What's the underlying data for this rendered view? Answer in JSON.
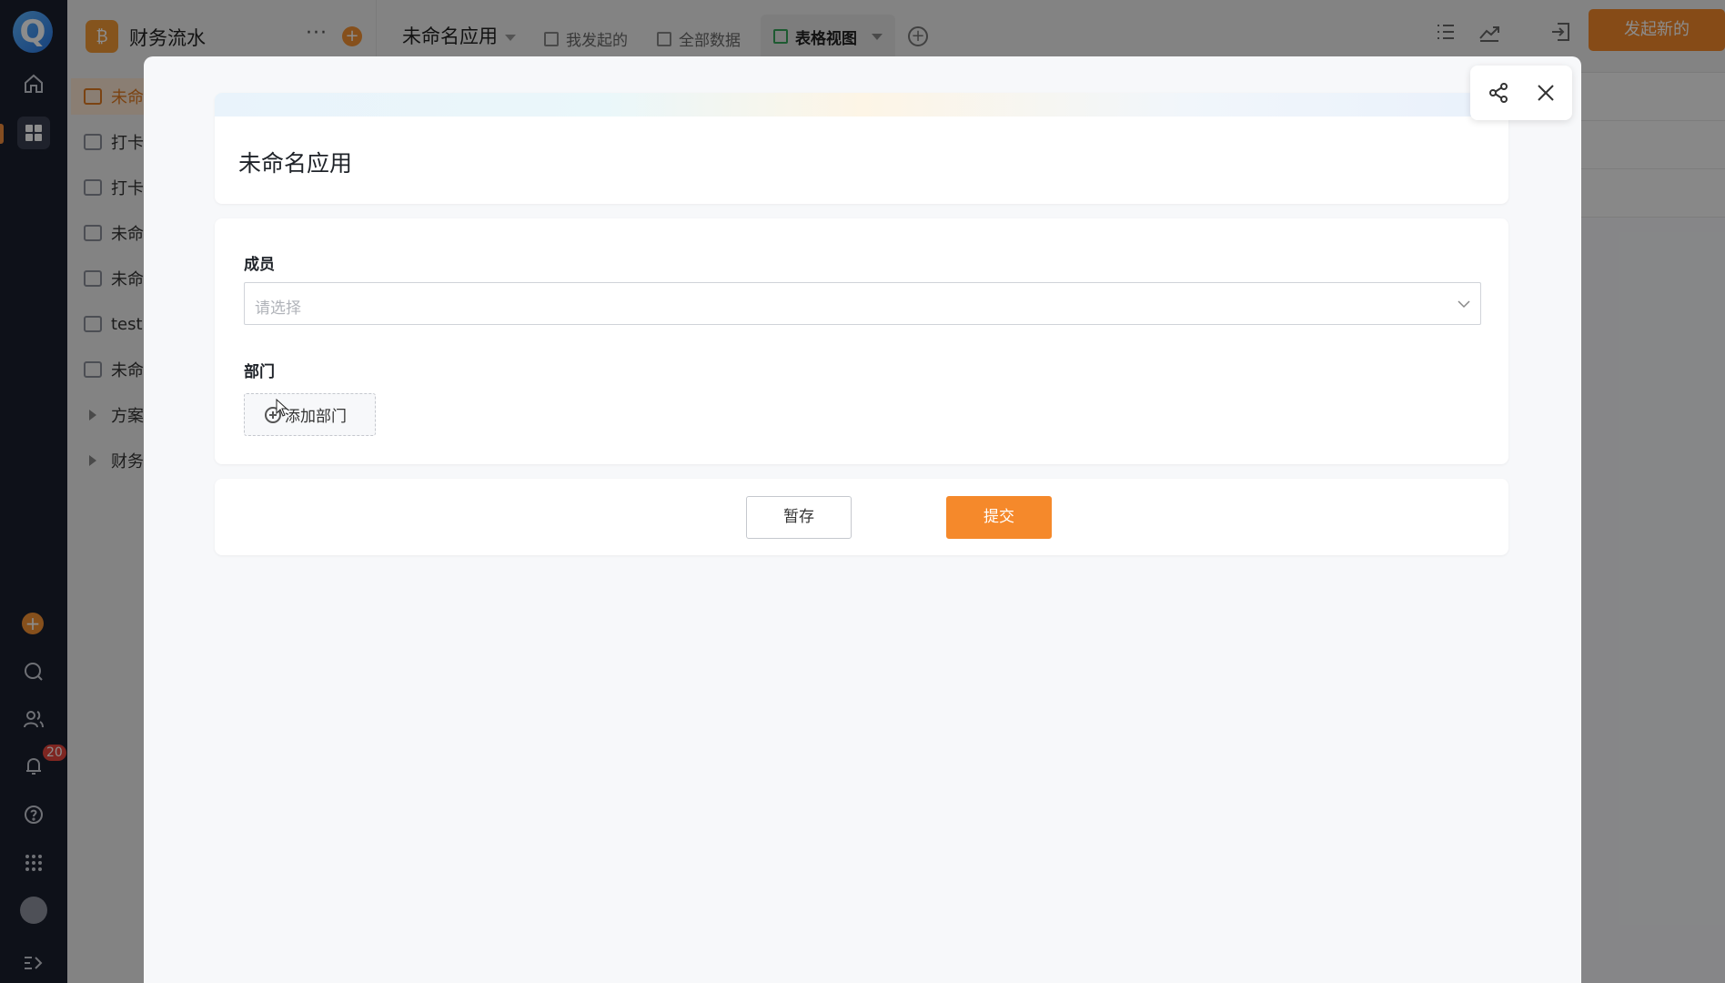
{
  "sidebar": {
    "app_title": "财务流水",
    "more": "···",
    "items": [
      {
        "label": "未命",
        "selected": true,
        "kind": "form"
      },
      {
        "label": "打卡",
        "kind": "form"
      },
      {
        "label": "打卡",
        "kind": "form"
      },
      {
        "label": "未命",
        "kind": "form"
      },
      {
        "label": "未命",
        "kind": "form"
      },
      {
        "label": "test",
        "kind": "form"
      },
      {
        "label": "未命",
        "kind": "board"
      },
      {
        "label": "方案",
        "kind": "folder"
      },
      {
        "label": "财务",
        "kind": "folder"
      }
    ]
  },
  "rail": {
    "notification_count": "20"
  },
  "topbar": {
    "title": "未命名应用",
    "tabs": [
      {
        "label": "我发起的"
      },
      {
        "label": "全部数据"
      },
      {
        "label": "表格视图",
        "current": true
      }
    ],
    "new_button": "发起新的"
  },
  "modal": {
    "form_title": "未命名应用",
    "fields": [
      {
        "label": "成员",
        "placeholder": "请选择"
      },
      {
        "label": "部门",
        "button": "添加部门"
      }
    ],
    "save_button": "暂存",
    "submit_button": "提交"
  },
  "colors": {
    "accent": "#f5892b",
    "rail_bg": "#1b1f2e"
  }
}
